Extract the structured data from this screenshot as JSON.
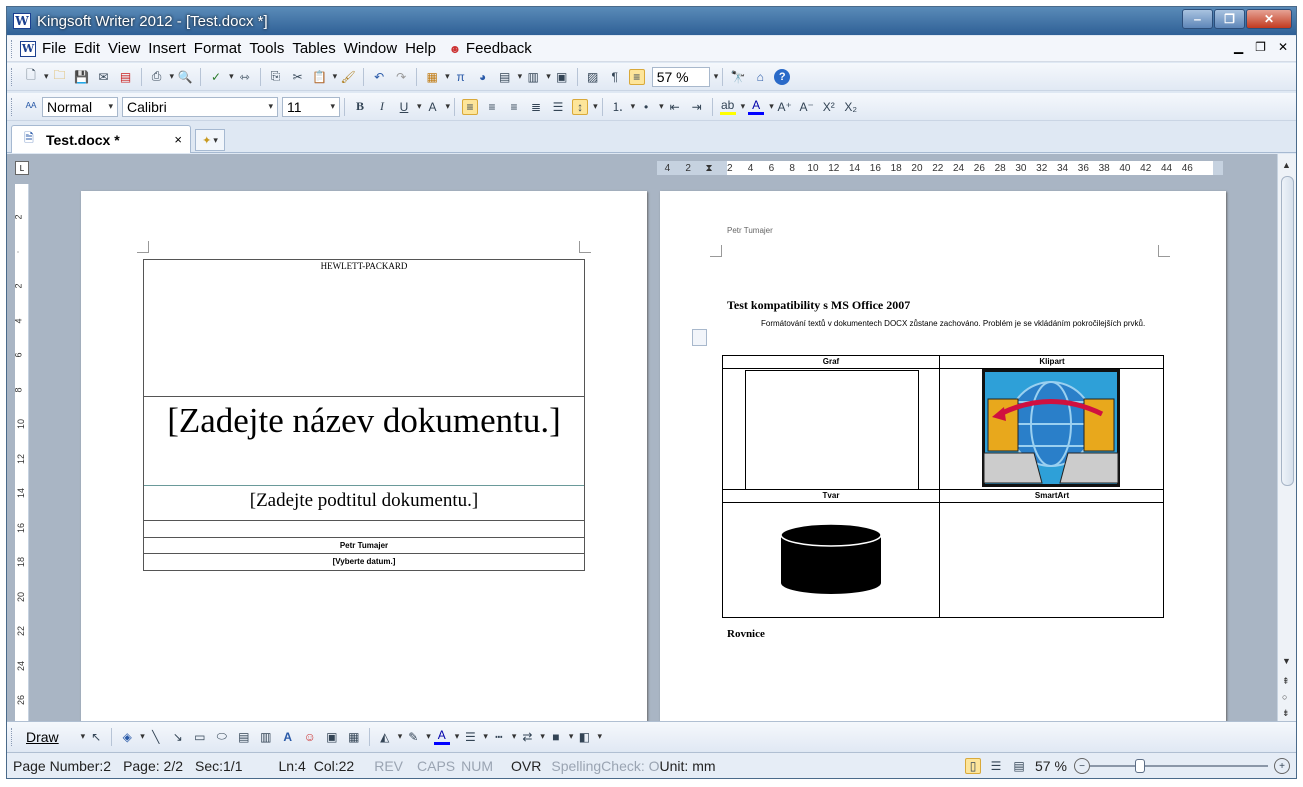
{
  "window": {
    "title": "Kingsoft Writer 2012 - [Test.docx *]",
    "app_icon": "W"
  },
  "menu": {
    "items": [
      "File",
      "Edit",
      "View",
      "Insert",
      "Format",
      "Tools",
      "Tables",
      "Window",
      "Help",
      "Feedback"
    ]
  },
  "toolbar": {
    "zoom": "57 %"
  },
  "format_bar": {
    "style": "Normal",
    "font": "Calibri",
    "size": "11"
  },
  "tabs": {
    "doc_label": "Test.docx *",
    "close_glyph": "×"
  },
  "ruler": {
    "h_labels": [
      "4",
      "2",
      "",
      "2",
      "4",
      "6",
      "8",
      "10",
      "12",
      "14",
      "16",
      "18",
      "20",
      "22",
      "24",
      "26",
      "28",
      "30",
      "32",
      "34",
      "36",
      "38",
      "40",
      "42",
      "44",
      "46"
    ],
    "v_labels": [
      "2",
      "",
      "2",
      "4",
      "6",
      "8",
      "10",
      "12",
      "14",
      "16",
      "18",
      "20",
      "22",
      "24",
      "26"
    ]
  },
  "page1": {
    "company": "HEWLETT-PACKARD",
    "title": "[Zadejte název dokumentu.]",
    "subtitle": "[Zadejte podtitul dokumentu.]",
    "author": "Petr Tumajer",
    "date": "[Vyberte datum.]"
  },
  "page2": {
    "header": "Petr Tumajer",
    "heading": "Test kompatibility s MS Office 2007",
    "body": "Formátování textů v dokumentech DOCX zůstane zachováno. Problém je se vkládáním pokročilejších prvků.",
    "table": {
      "headers": [
        "Graf",
        "Klipart",
        "Tvar",
        "SmartArt"
      ]
    },
    "footer_heading": "Rovnice"
  },
  "drawbar": {
    "draw_label": "Draw"
  },
  "status": {
    "page_number": "Page Number:2",
    "page": "Page: 2/2",
    "sec": "Sec:1/1",
    "ln": "Ln:4",
    "col": "Col:22",
    "rev": "REV",
    "caps": "CAPS",
    "num": "NUM",
    "ovr": "OVR",
    "spelling": "SpellingCheck: O",
    "unit": "Unit: mm",
    "zoom": "57 %"
  }
}
